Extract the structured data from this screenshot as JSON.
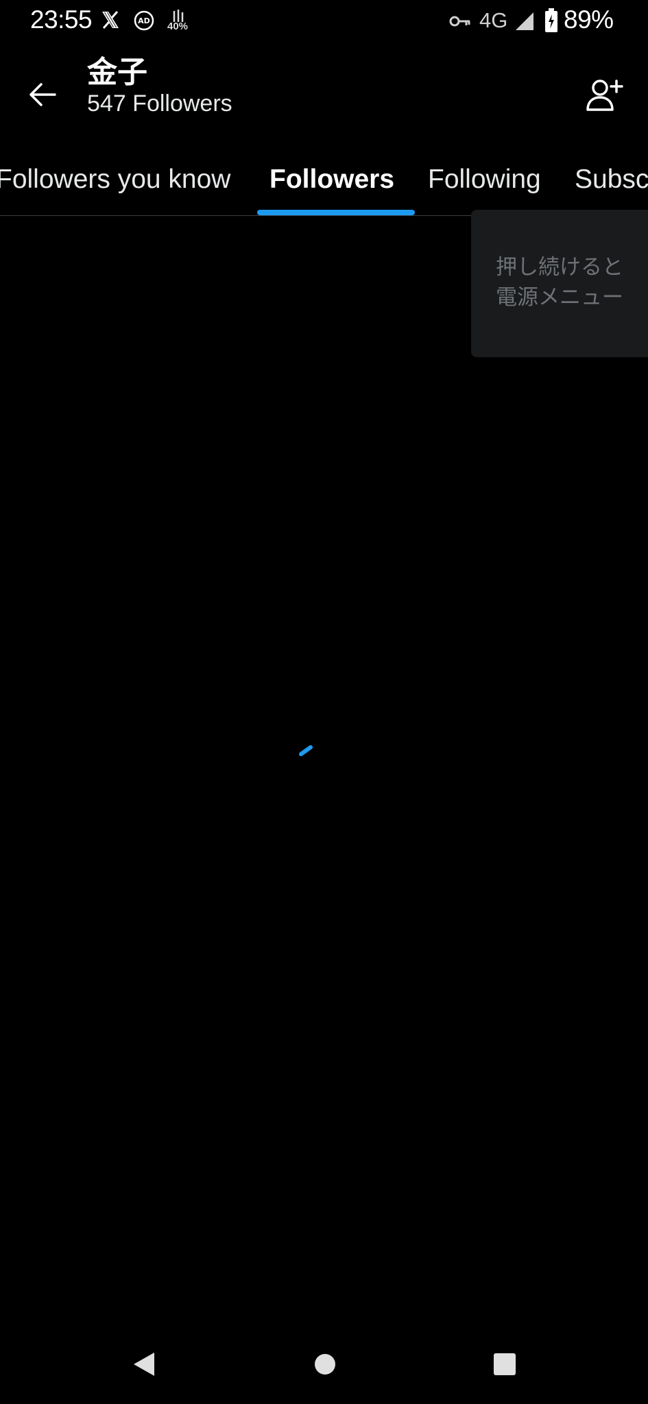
{
  "status_bar": {
    "time": "23:55",
    "usage_percent_label": "40%",
    "network": "4G",
    "battery": "89%",
    "icons": [
      "x-logo-icon",
      "ad-block-icon",
      "data-usage-icon",
      "vpn-key-icon",
      "signal-icon",
      "battery-charging-icon"
    ]
  },
  "header": {
    "name": "金子",
    "followers_label": "547 Followers",
    "back_icon": "arrow-left-icon",
    "follow_icon": "add-person-icon"
  },
  "tabs": [
    {
      "label": "Followers you know",
      "active": false
    },
    {
      "label": "Followers",
      "active": true
    },
    {
      "label": "Following",
      "active": false
    },
    {
      "label": "Subsc",
      "active": false
    }
  ],
  "tooltip": {
    "text": "押し続けると\n電源メニュー"
  },
  "loading": {
    "spinner_color": "#1d9bf0"
  },
  "nav_bar": {
    "back_icon": "triangle-back-icon",
    "home_icon": "circle-home-icon",
    "recents_icon": "square-recents-icon"
  },
  "colors": {
    "background": "#000000",
    "accent": "#1d9bf0",
    "divider": "#3a3d40",
    "tooltip_bg": "#1a1b1d",
    "tooltip_text": "#6e7276"
  }
}
